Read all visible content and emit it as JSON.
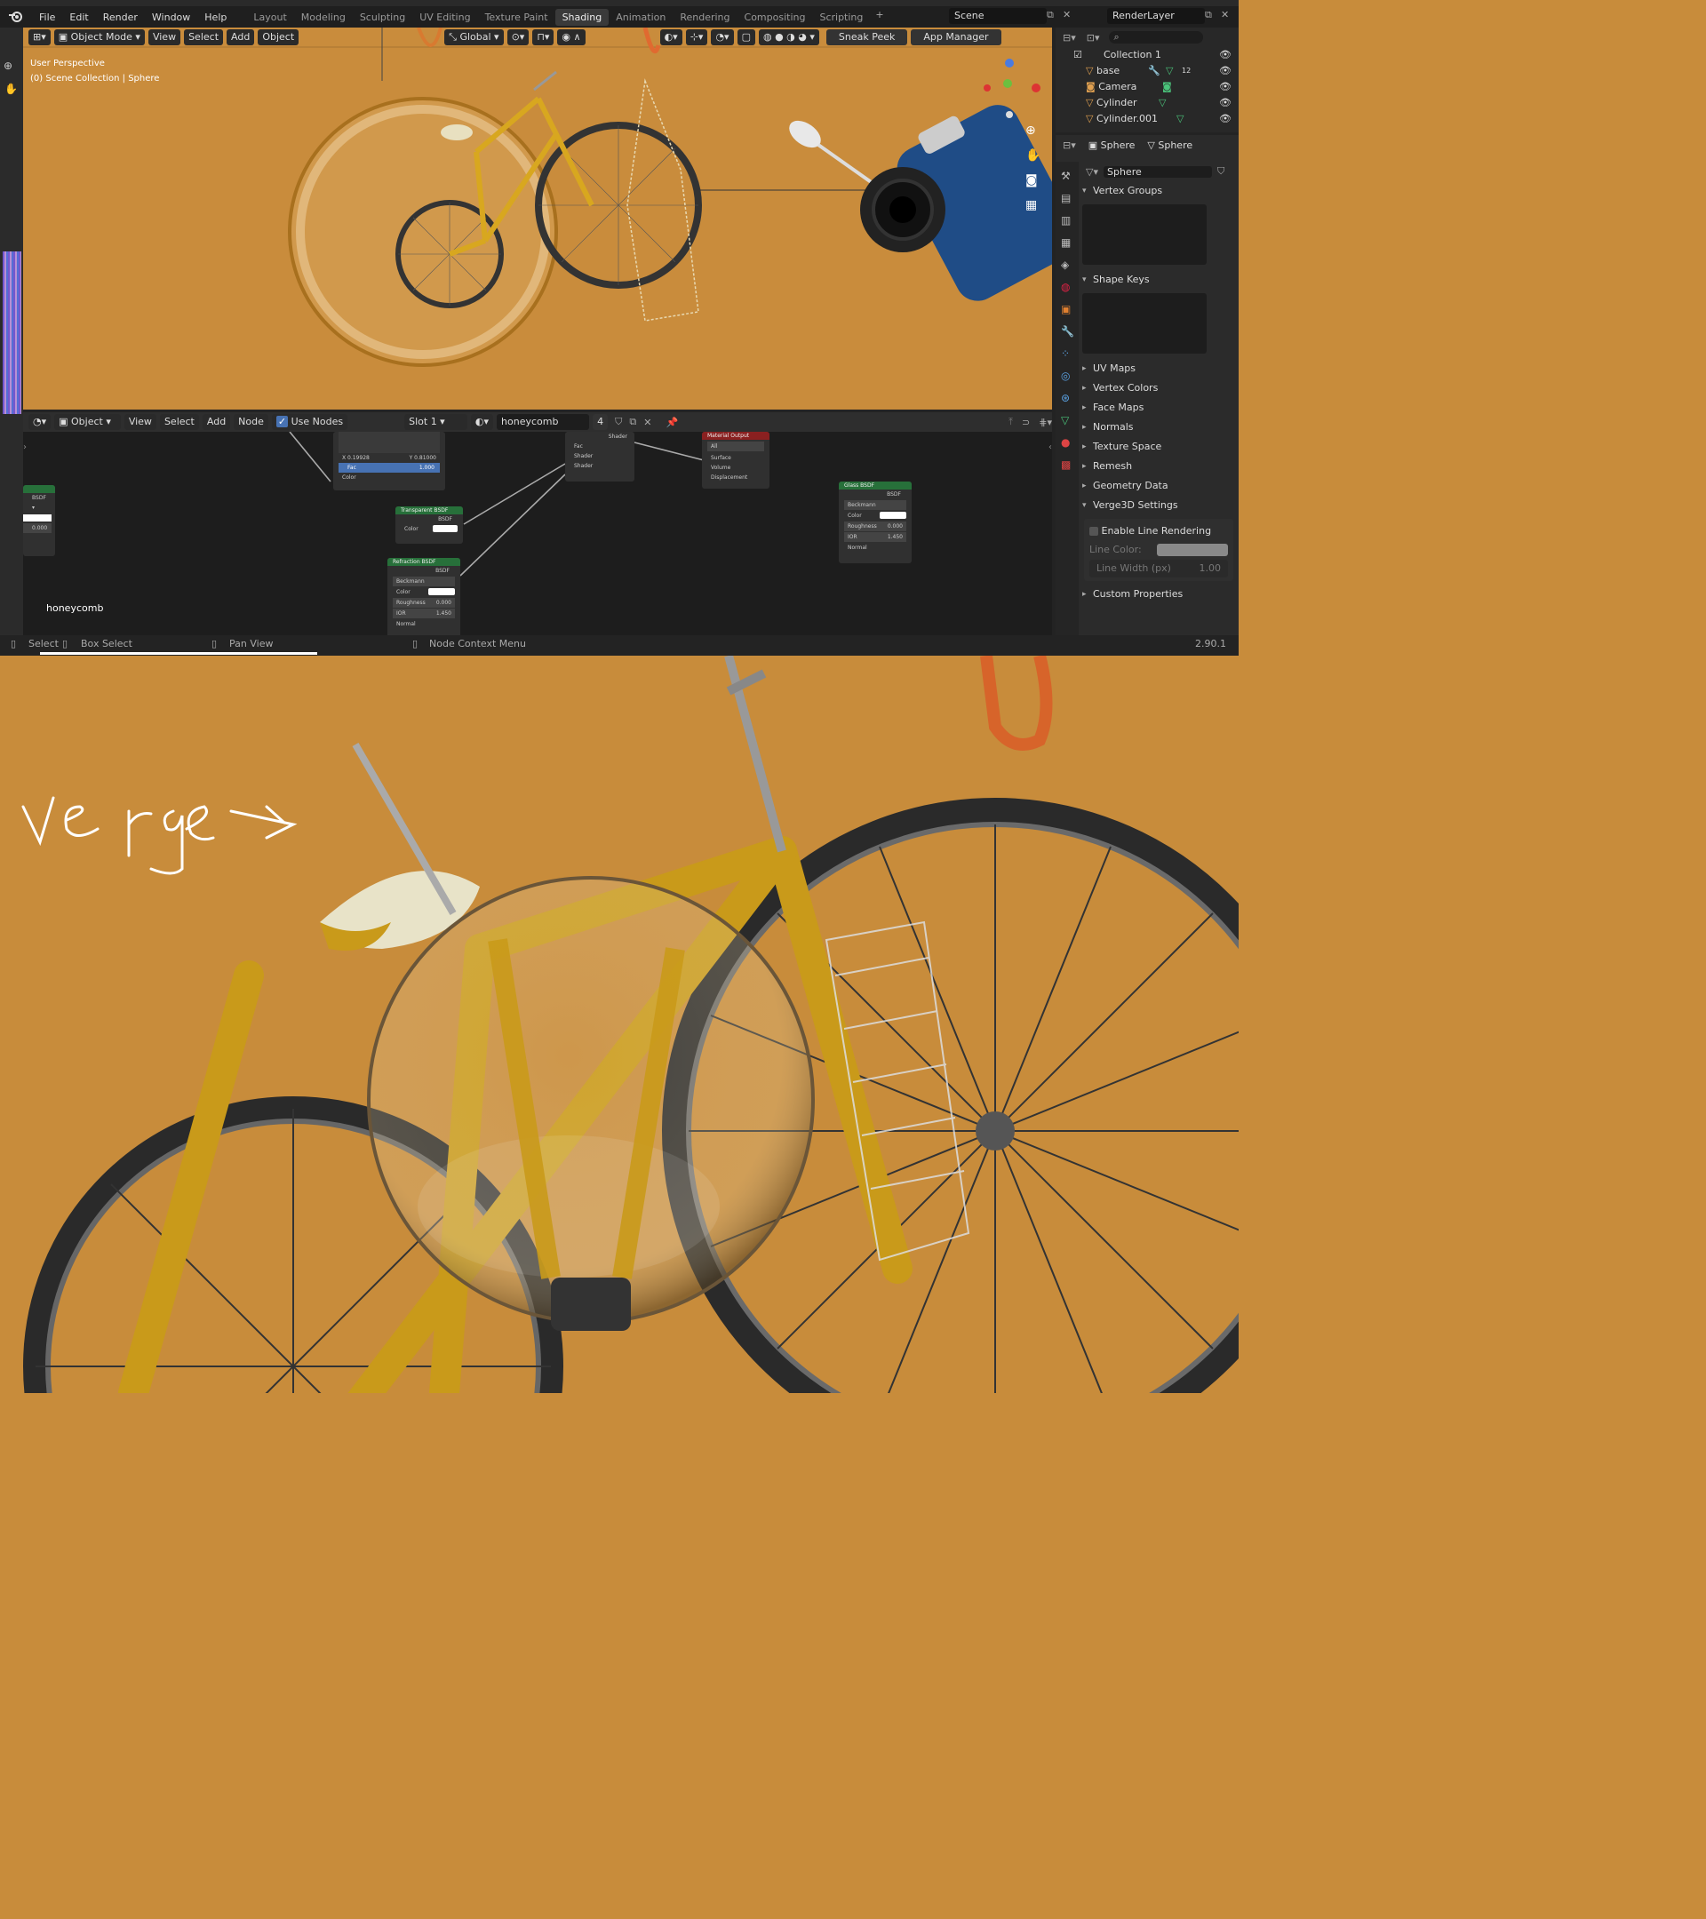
{
  "menu": [
    "File",
    "Edit",
    "Render",
    "Window",
    "Help"
  ],
  "workspaces": [
    "Layout",
    "Modeling",
    "Sculpting",
    "UV Editing",
    "Texture Paint",
    "Shading",
    "Animation",
    "Rendering",
    "Compositing",
    "Scripting"
  ],
  "active_workspace": "Shading",
  "scene_name": "Scene",
  "view_layer": "RenderLayer",
  "viewport_header": {
    "mode": "Object Mode",
    "menus": [
      "View",
      "Select",
      "Add",
      "Object"
    ],
    "transform": "Global",
    "sneak_peek": "Sneak Peek",
    "app_manager": "App Manager"
  },
  "viewport_info": {
    "line1": "User Perspective",
    "line2": "(0) Scene Collection | Sphere"
  },
  "outliner": {
    "collection": "Collection 1",
    "items": [
      "base",
      "Camera",
      "Cylinder",
      "Cylinder.001"
    ],
    "base_badge": "12"
  },
  "properties": {
    "breadcrumb_object": "Sphere",
    "breadcrumb_data": "Sphere",
    "mesh_name": "Sphere",
    "panels_top": [
      "Vertex Groups",
      "Shape Keys"
    ],
    "panels": [
      "UV Maps",
      "Vertex Colors",
      "Face Maps",
      "Normals",
      "Texture Space",
      "Remesh",
      "Geometry Data"
    ],
    "verge_panel": "Verge3D Settings",
    "enable_line_rendering": "Enable Line Rendering",
    "line_color_label": "Line Color:",
    "line_width_label": "Line Width (px)",
    "line_width_value": "1.00",
    "custom_properties": "Custom Properties"
  },
  "node_header": {
    "mode": "Object",
    "menus": [
      "View",
      "Select",
      "Add",
      "Node"
    ],
    "use_nodes": "Use Nodes",
    "slot": "Slot 1",
    "material": "honeycomb",
    "users": "4"
  },
  "nodes": {
    "mix_x": "X 0.19928",
    "mix_y": "Y 0.81000",
    "fac_label": "Fac",
    "fac_value": "1.000",
    "color": "Color",
    "bsdf": "BSDF",
    "shader": "Shader",
    "left_value": "0.000",
    "transparent_title": "Transparent BSDF",
    "refraction_title": "Refraction BSDF",
    "glass_title": "Glass BSDF",
    "material_output": "Material Output",
    "all": "All",
    "surface": "Surface",
    "volume": "Volume",
    "displacement": "Displacement",
    "beckmann": "Beckmann",
    "roughness": "Roughness",
    "roughness_value": "0.000",
    "ior": "IOR",
    "ior_value": "1.450",
    "normal": "Normal",
    "fac": "Fac",
    "editor_label": "honeycomb"
  },
  "status": {
    "select": "Select",
    "box_select": "Box Select",
    "pan_view": "Pan View",
    "node_context_menu": "Node Context Menu",
    "version": "2.90.1"
  },
  "handwriting": "Verge ->"
}
